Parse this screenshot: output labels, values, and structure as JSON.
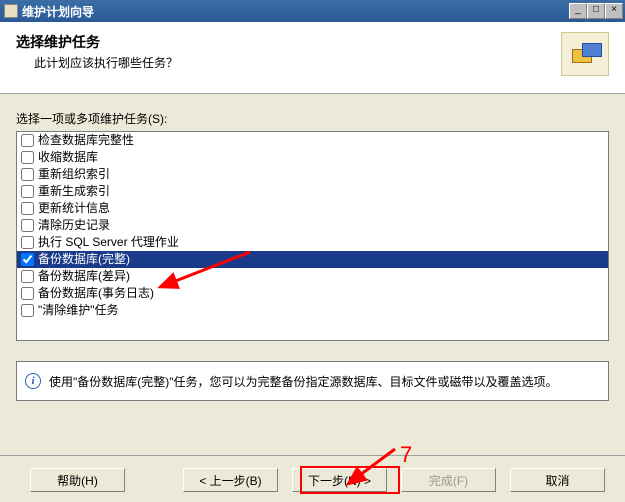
{
  "window": {
    "title": "维护计划向导"
  },
  "header": {
    "title": "选择维护任务",
    "subtitle": "此计划应该执行哪些任务？"
  },
  "body": {
    "listLabel": "选择一项或多项维护任务(S):",
    "tasks": [
      {
        "label": "检查数据库完整性",
        "checked": false,
        "selected": false
      },
      {
        "label": "收缩数据库",
        "checked": false,
        "selected": false
      },
      {
        "label": "重新组织索引",
        "checked": false,
        "selected": false
      },
      {
        "label": "重新生成索引",
        "checked": false,
        "selected": false
      },
      {
        "label": "更新统计信息",
        "checked": false,
        "selected": false
      },
      {
        "label": "清除历史记录",
        "checked": false,
        "selected": false
      },
      {
        "label": "执行 SQL Server 代理作业",
        "checked": false,
        "selected": false
      },
      {
        "label": "备份数据库(完整)",
        "checked": true,
        "selected": true
      },
      {
        "label": "备份数据库(差异)",
        "checked": false,
        "selected": false
      },
      {
        "label": "备份数据库(事务日志)",
        "checked": false,
        "selected": false
      },
      {
        "label": "\"清除维护\"任务",
        "checked": false,
        "selected": false
      }
    ],
    "infoText": "使用\"备份数据库(完整)\"任务，您可以为完整备份指定源数据库、目标文件或磁带以及覆盖选项。"
  },
  "buttons": {
    "help": "帮助(H)",
    "back": "< 上一步(B)",
    "next": "下一步(N) >",
    "finish": "完成(F)",
    "cancel": "取消"
  },
  "annotations": {
    "label7": "7"
  }
}
